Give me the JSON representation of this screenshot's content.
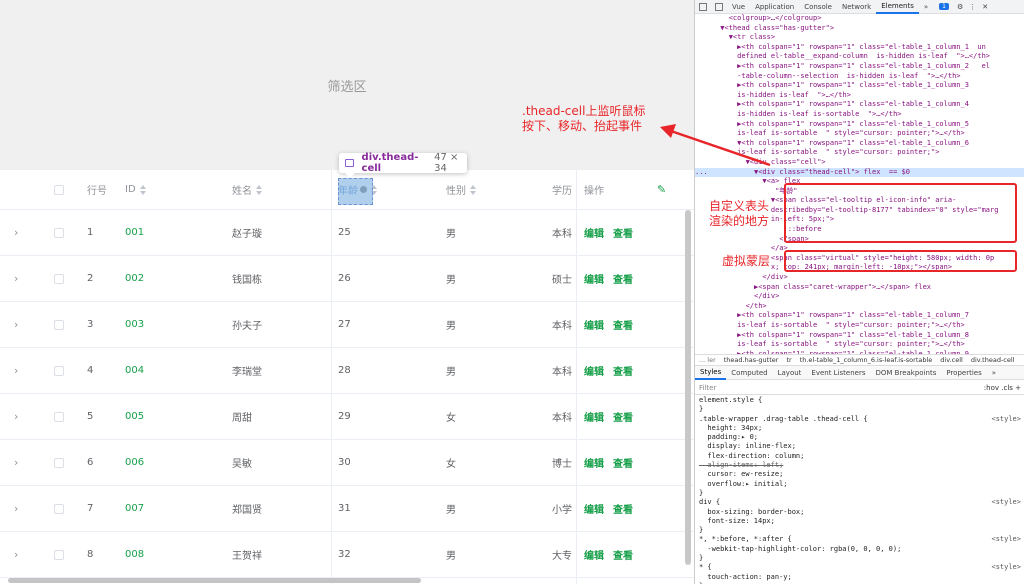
{
  "filter_area": {
    "label": "筛选区"
  },
  "table": {
    "headers": {
      "no": "行号",
      "id": "ID",
      "name": "姓名",
      "age": "年龄",
      "gender": "性别",
      "edu": "学历",
      "ops": "操作"
    },
    "rows": [
      {
        "no": "1",
        "id": "001",
        "name": "赵子璇",
        "age": "25",
        "gender": "男",
        "edu": "本科"
      },
      {
        "no": "2",
        "id": "002",
        "name": "钱国栋",
        "age": "26",
        "gender": "男",
        "edu": "硕士"
      },
      {
        "no": "3",
        "id": "003",
        "name": "孙夫子",
        "age": "27",
        "gender": "男",
        "edu": "本科"
      },
      {
        "no": "4",
        "id": "004",
        "name": "李瑞堂",
        "age": "28",
        "gender": "男",
        "edu": "本科"
      },
      {
        "no": "5",
        "id": "005",
        "name": "周甜",
        "age": "29",
        "gender": "女",
        "edu": "本科"
      },
      {
        "no": "6",
        "id": "006",
        "name": "吴敏",
        "age": "30",
        "gender": "女",
        "edu": "博士"
      },
      {
        "no": "7",
        "id": "007",
        "name": "郑国贤",
        "age": "31",
        "gender": "男",
        "edu": "小学"
      },
      {
        "no": "8",
        "id": "008",
        "name": "王贺祥",
        "age": "32",
        "gender": "男",
        "edu": "大专"
      }
    ],
    "edit_label": "编辑",
    "view_label": "查看"
  },
  "tooltip": {
    "tag": "div.thead-cell",
    "size": "47 × 34"
  },
  "annotations": {
    "thead_line1": ".thead-cell上监听鼠标",
    "thead_line2": "按下、移动、抬起事件",
    "custom_line1": "自定义表头",
    "custom_line2": "渲染的地方",
    "virtual": "虚拟蒙层"
  },
  "devtools": {
    "tabs": [
      "Vue",
      "Application",
      "Console",
      "Network",
      "Elements",
      "»"
    ],
    "active_tab": "Elements",
    "badge": "1",
    "dom_lines": [
      "        <colgroup>…</colgroup>",
      "      ▼<thead class=\"has-gutter\">",
      "        ▼<tr class>",
      "          ▶<th colspan=\"1\" rowspan=\"1\" class=\"el-table_1_column_1  un",
      "          defined el-table__expand-column  is-hidden is-leaf  \">…</th>",
      "          ▶<th colspan=\"1\" rowspan=\"1\" class=\"el-table_1_column_2   el",
      "          -table-column--selection  is-hidden is-leaf  \">…</th>",
      "          ▶<th colspan=\"1\" rowspan=\"1\" class=\"el-table_1_column_3",
      "          is-hidden is-leaf  \">…</th>",
      "          ▶<th colspan=\"1\" rowspan=\"1\" class=\"el-table_1_column_4",
      "          is-hidden is-leaf is-sortable  \">…</th>",
      "          ▶<th colspan=\"1\" rowspan=\"1\" class=\"el-table_1_column_5",
      "          is-leaf is-sortable  \" style=\"cursor: pointer;\">…</th>",
      "          ▼<th colspan=\"1\" rowspan=\"1\" class=\"el-table_1_column_6",
      "          is-leaf is-sortable  \" style=\"cursor: pointer;\">",
      "            ▼<div class=\"cell\">",
      "...           ▼<div class=\"thead-cell\"> flex  == $0",
      "                ▼<a> flex",
      "                   \"年龄\"",
      "                  ▼<span class=\"el-tooltip el-icon-info\" aria-",
      "                  describedby=\"el-tooltip-8177\" tabindex=\"0\" style=\"marg",
      "                  in-left: 5px;\">",
      "                      ::before",
      "                    </span>",
      "                  </a>",
      "                  <span class=\"virtual\" style=\"height: 580px; width: 0p",
      "                  x; top: 241px; margin-left: -10px;\"></span>",
      "                </div>",
      "              ▶<span class=\"caret-wrapper\">…</span> flex",
      "              </div>",
      "            </th>",
      "          ▶<th colspan=\"1\" rowspan=\"1\" class=\"el-table_1_column_7",
      "          is-leaf is-sortable  \" style=\"cursor: pointer;\">…</th>",
      "          ▶<th colspan=\"1\" rowspan=\"1\" class=\"el-table_1_column_8",
      "          is-leaf is-sortable  \" style=\"cursor: pointer;\">…</th>",
      "          ▶<th colspan=\"1\" rowspan=\"1\" class=\"el-table_1_column_9"
    ],
    "breadcrumbs": [
      "... ler",
      "thead.has-gutter",
      "tr",
      "th.el-table_1_column_6.is-leaf.is-sortable",
      "div.cell",
      "div.thead-cell"
    ],
    "styles_tabs": [
      "Styles",
      "Computed",
      "Layout",
      "Event Listeners",
      "DOM Breakpoints",
      "Properties",
      "»"
    ],
    "filter_placeholder": "Filter",
    "filter_right": ":hov  .cls  +",
    "css_lines": [
      {
        "text": "element.style {",
        "src": ""
      },
      {
        "text": "}",
        "src": ""
      },
      {
        "text": ".table-wrapper .drag-table .thead-cell {",
        "src": "<style>"
      },
      {
        "text": "  height: 34px;",
        "src": ""
      },
      {
        "text": "  padding:▸ 0;",
        "src": ""
      },
      {
        "text": "  display: inline-flex;",
        "src": ""
      },
      {
        "text": "  flex-direction: column;",
        "src": ""
      },
      {
        "text": "  align-items: left;",
        "src": "",
        "strike": true
      },
      {
        "text": "  cursor: ew-resize;",
        "src": ""
      },
      {
        "text": "  overflow:▸ initial;",
        "src": ""
      },
      {
        "text": "}",
        "src": ""
      },
      {
        "text": "div {",
        "src": "<style>"
      },
      {
        "text": "  box-sizing: border-box;",
        "src": ""
      },
      {
        "text": "  font-size: 14px;",
        "src": ""
      },
      {
        "text": "}",
        "src": ""
      },
      {
        "text": "*, *:before, *:after {",
        "src": "<style>"
      },
      {
        "text": "  -webkit-tap-highlight-color: rgba(0, 0, 0, 0);",
        "src": ""
      },
      {
        "text": "}",
        "src": ""
      },
      {
        "text": "* {",
        "src": "<style>"
      },
      {
        "text": "  touch-action: pan-y;",
        "src": ""
      },
      {
        "text": "}",
        "src": ""
      }
    ]
  },
  "colors": {
    "accent_green": "#17a04a",
    "annotation_red": "#e8262a",
    "devtools_blue": "#1a73e8"
  }
}
